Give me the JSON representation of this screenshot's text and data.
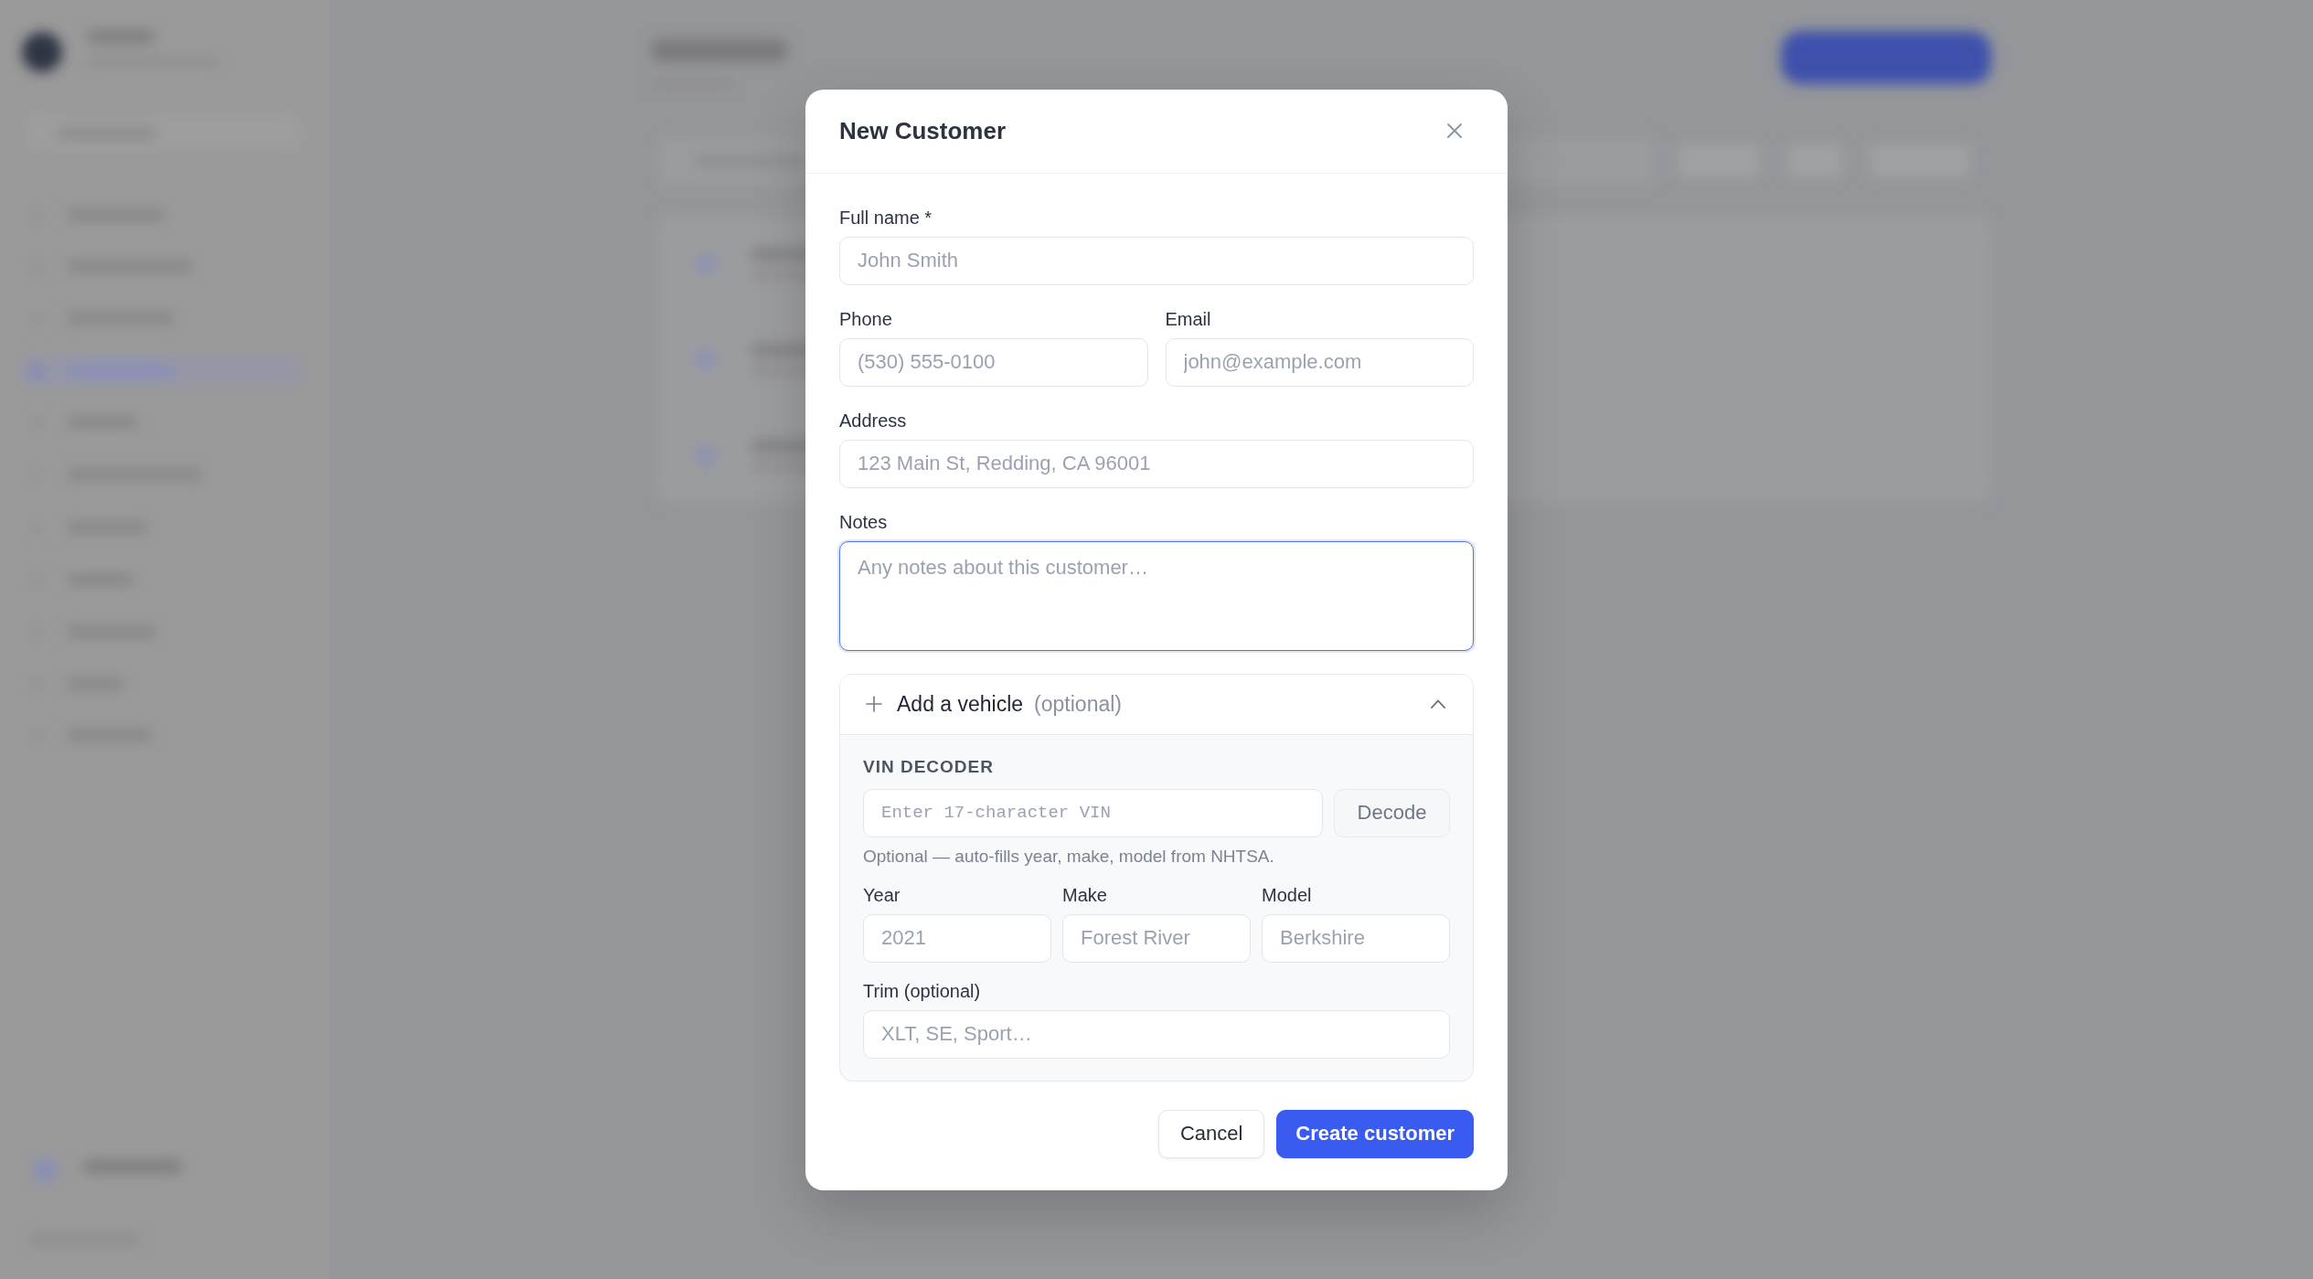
{
  "dialog": {
    "title": "New Customer"
  },
  "form_rows": [
    {
      "fields": [
        {
          "kind": "text",
          "label": "Full name *",
          "placeholder": "John Smith",
          "focused": false
        }
      ]
    },
    {
      "fields": [
        {
          "kind": "text",
          "label": "Phone",
          "placeholder": "(530) 555-0100",
          "focused": false
        },
        {
          "kind": "text",
          "label": "Email",
          "placeholder": "john@example.com",
          "focused": false
        }
      ]
    },
    {
      "fields": [
        {
          "kind": "text",
          "label": "Address",
          "placeholder": "123 Main St, Redding, CA 96001",
          "focused": false
        }
      ]
    },
    {
      "fields": [
        {
          "kind": "textarea",
          "label": "Notes",
          "placeholder": "Any notes about this customer…",
          "focused": true
        }
      ]
    }
  ],
  "vehicle": {
    "title": "Add a vehicle",
    "hint": "(optional)",
    "expanded": true,
    "vin_decoder": {
      "heading": "VIN DECODER",
      "placeholder": "Enter 17-character VIN",
      "button": {
        "label": "Decode",
        "disabled": true
      },
      "help": "Optional — auto-fills year, make, model from NHTSA."
    },
    "rows": [
      {
        "fields": [
          {
            "kind": "text",
            "label": "Year",
            "placeholder": "2021",
            "focused": false
          },
          {
            "kind": "text",
            "label": "Make",
            "placeholder": "Forest River",
            "focused": false
          },
          {
            "kind": "text",
            "label": "Model",
            "placeholder": "Berkshire",
            "focused": false
          }
        ]
      },
      {
        "fields": [
          {
            "kind": "text",
            "label": "Trim (optional)",
            "placeholder": "XLT, SE, Sport…",
            "focused": false
          }
        ]
      }
    ]
  },
  "buttons": [
    {
      "kind": "secondary",
      "label": "Cancel"
    },
    {
      "kind": "primary",
      "label": "Create customer"
    }
  ]
}
